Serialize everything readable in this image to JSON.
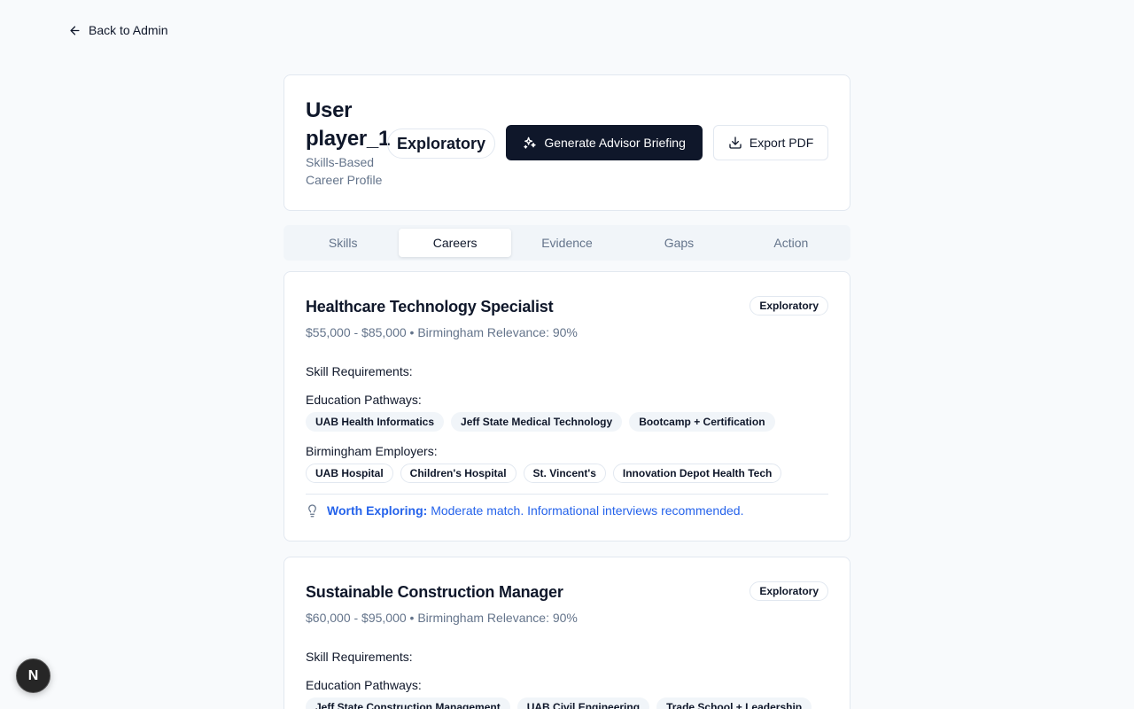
{
  "nav": {
    "back_label": "Back to Admin"
  },
  "header": {
    "title": "User player_1",
    "subtitle": "Skills-Based Career Profile",
    "badge": "Exploratory",
    "generate_label": "Generate Advisor Briefing",
    "export_label": "Export PDF"
  },
  "tabs": [
    {
      "label": "Skills"
    },
    {
      "label": "Careers"
    },
    {
      "label": "Evidence"
    },
    {
      "label": "Gaps"
    },
    {
      "label": "Action"
    }
  ],
  "active_tab": "Careers",
  "careers": [
    {
      "title": "Healthcare Technology Specialist",
      "badge": "Exploratory",
      "salary": "$55,000 - $85,000",
      "relevance": "Birmingham Relevance: 90%",
      "skill_label": "Skill Requirements:",
      "edu_label": "Education Pathways:",
      "education": [
        "UAB Health Informatics",
        "Jeff State Medical Technology",
        "Bootcamp + Certification"
      ],
      "emp_label": "Birmingham Employers:",
      "employers": [
        "UAB Hospital",
        "Children's Hospital",
        "St. Vincent's",
        "Innovation Depot Health Tech"
      ],
      "insight_strong": "Worth Exploring:",
      "insight_text": "Moderate match. Informational interviews recommended."
    },
    {
      "title": "Sustainable Construction Manager",
      "badge": "Exploratory",
      "salary": "$60,000 - $95,000",
      "relevance": "Birmingham Relevance: 90%",
      "skill_label": "Skill Requirements:",
      "edu_label": "Education Pathways:",
      "education": [
        "Jeff State Construction Management",
        "UAB Civil Engineering",
        "Trade School + Leadership"
      ]
    }
  ],
  "dev_badge": "N",
  "colors": {
    "primary": "#0f172a",
    "accent_blue": "#2563eb",
    "muted": "#64748b",
    "border": "#e2e8f0"
  }
}
